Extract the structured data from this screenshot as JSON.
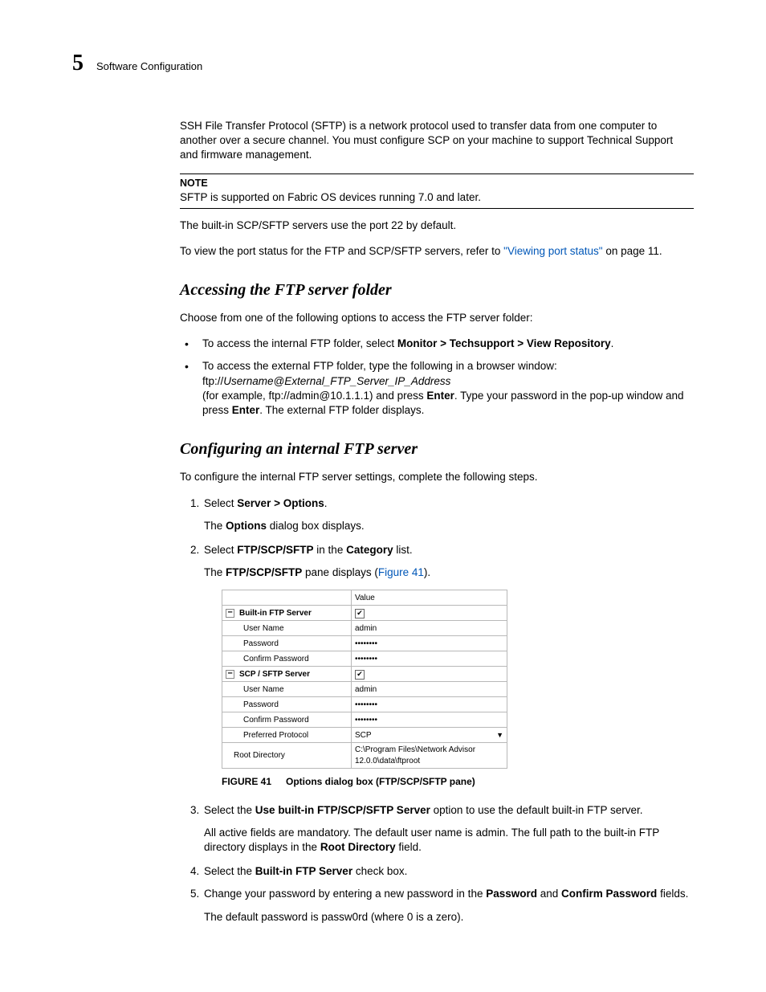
{
  "header": {
    "chapter_num": "5",
    "section": "Software Configuration"
  },
  "intro": {
    "sftp_para": "SSH File Transfer Protocol (SFTP) is a network protocol used to transfer data from one computer to another over a secure channel. You must configure SCP on your machine to support Technical Support and firmware management.",
    "note_label": "NOTE",
    "note_body": "SFTP is supported on Fabric OS devices running 7.0 and later.",
    "port_para": "The built-in SCP/SFTP servers use the port 22 by default.",
    "viewport_pre": "To view the port status for the FTP and SCP/SFTP servers, refer to ",
    "viewport_link": "\"Viewing port status\"",
    "viewport_post": " on page 11."
  },
  "access": {
    "heading": "Accessing the FTP server folder",
    "lead": "Choose from one of the following options to access the FTP server folder:",
    "b1_pre": "To access the internal FTP folder, select ",
    "b1_bold": "Monitor > Techsupport > View Repository",
    "b1_post": ".",
    "b2_l1": "To access the external FTP folder, type the following in a browser window:",
    "b2_l2_pre": "ftp://",
    "b2_l2_it": "Username@External_FTP_Server_IP_Address",
    "b2_l3_pre": "(for example, ftp://admin@10.1.1.1) and press ",
    "b2_l3_b1": "Enter",
    "b2_l3_mid": ". Type your password in the pop-up window and press ",
    "b2_l3_b2": "Enter",
    "b2_l3_post": ". The external FTP folder displays."
  },
  "config": {
    "heading": "Configuring an internal FTP server",
    "lead": "To configure the internal FTP server settings, complete the following steps.",
    "s1_pre": "Select ",
    "s1_bold": "Server > Options",
    "s1_post": ".",
    "s1_sub_pre": "The ",
    "s1_sub_b": "Options",
    "s1_sub_post": " dialog box displays.",
    "s2_pre": "Select ",
    "s2_b1": "FTP/SCP/SFTP",
    "s2_mid": " in the ",
    "s2_b2": "Category",
    "s2_post": " list.",
    "s2_sub_pre": "The ",
    "s2_sub_b": "FTP/SCP/SFTP",
    "s2_sub_mid": " pane displays (",
    "s2_sub_link": "Figure 41",
    "s2_sub_post": ").",
    "s3_pre": "Select the ",
    "s3_b": "Use built-in FTP/SCP/SFTP Server",
    "s3_post": " option to use the default built-in FTP server.",
    "s3_sub_pre": "All active fields are mandatory. The default user name is admin. The full path to the built-in FTP directory displays in the ",
    "s3_sub_b": "Root Directory",
    "s3_sub_post": " field.",
    "s4_pre": "Select the ",
    "s4_b": "Built-in FTP Server",
    "s4_post": " check box.",
    "s5_pre": "Change your password by entering a new password in the ",
    "s5_b1": "Password",
    "s5_mid": " and ",
    "s5_b2": "Confirm Password",
    "s5_post": " fields.",
    "s5_sub": "The default password is passw0rd (where 0 is a zero)."
  },
  "figure": {
    "value_header": "Value",
    "g1": "Built-in FTP Server",
    "g2": "SCP / SFTP Server",
    "user": "User Name",
    "user_v": "admin",
    "pass": "Password",
    "pass_v": "••••••••",
    "conf": "Confirm Password",
    "conf_v": "••••••••",
    "proto": "Preferred Protocol",
    "proto_v": "SCP",
    "root": "Root Directory",
    "root_v": "C:\\Program Files\\Network Advisor 12.0.0\\data\\ftproot",
    "caption_label": "FIGURE 41",
    "caption_text": "Options dialog box (FTP/SCP/SFTP pane)"
  }
}
